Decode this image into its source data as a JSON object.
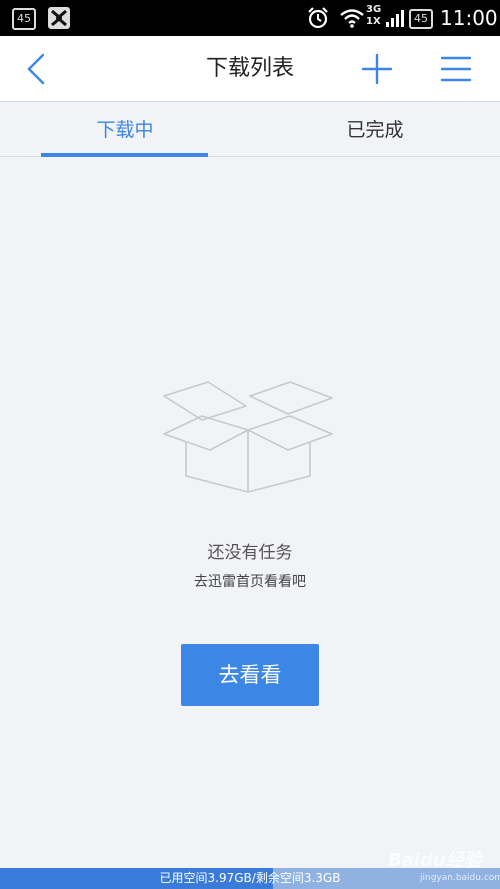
{
  "status_bar": {
    "left_badge": "45",
    "network_top": "3G",
    "network_bottom": "1X",
    "battery": "45",
    "time": "11:00"
  },
  "header": {
    "title": "下载列表",
    "back_icon": "chevron-left-icon",
    "add_icon": "plus-icon",
    "menu_icon": "hamburger-menu-icon"
  },
  "tabs": [
    {
      "label": "下载中",
      "active": true
    },
    {
      "label": "已完成",
      "active": false
    }
  ],
  "empty_state": {
    "icon": "empty-box-icon",
    "title": "还没有任务",
    "subtitle": "去迅雷首页看看吧",
    "button_label": "去看看"
  },
  "storage": {
    "text": "已用空间3.97GB/剩余空间3.3GB",
    "used_fraction": 0.546
  },
  "watermark": {
    "text": "Baidu经验",
    "sub": "jingyan.baidu.com"
  },
  "colors": {
    "accent": "#3c86e6",
    "background": "#f2f3f7",
    "storage_used": "#3a7ad8",
    "storage_free": "#8fb2e3"
  }
}
